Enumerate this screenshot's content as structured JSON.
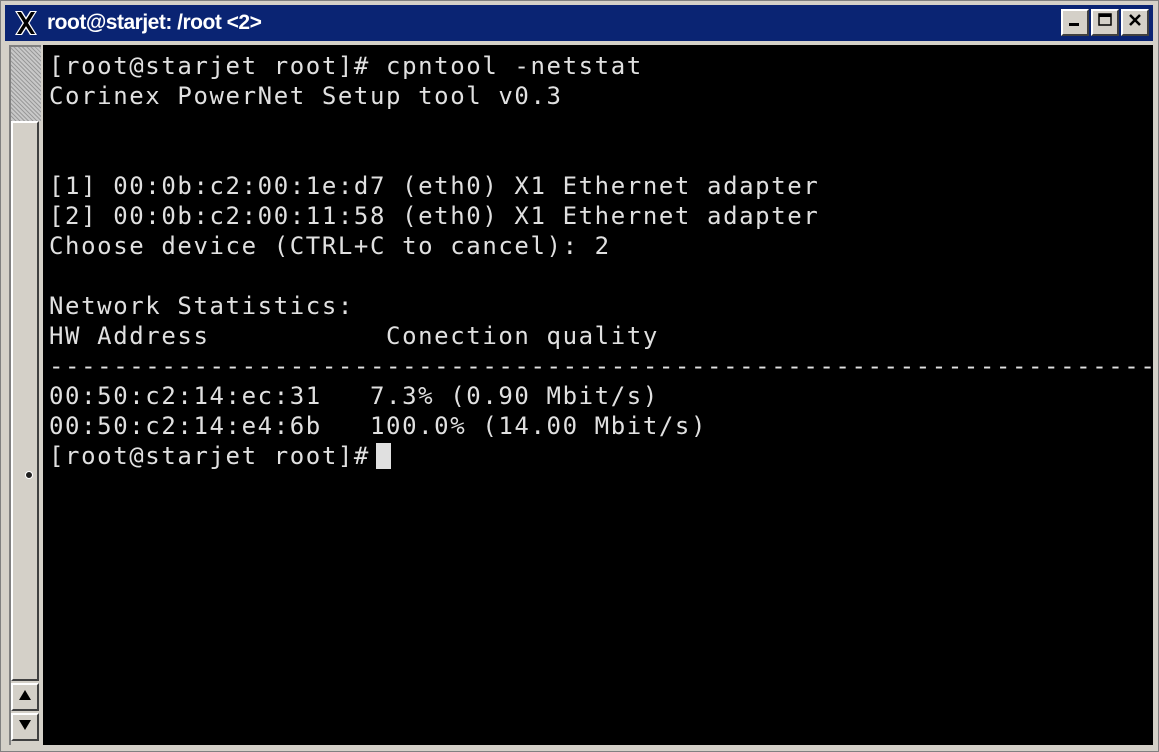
{
  "window": {
    "title": "root@starjet: /root <2>"
  },
  "icons": {
    "app": "x-logo-icon",
    "minimize": "minimize-icon",
    "maximize": "maximize-icon",
    "close": "close-icon",
    "scroll_up": "scroll-up-arrow-icon",
    "scroll_down": "scroll-down-arrow-icon"
  },
  "colors": {
    "titlebar": "#0a2473",
    "terminal_bg": "#000000",
    "terminal_fg": "#e0e0e0",
    "chrome": "#d4d0c8"
  },
  "terminal": {
    "lines": [
      "[root@starjet root]# cpntool -netstat",
      "Corinex PowerNet Setup tool v0.3",
      "",
      "",
      "[1] 00:0b:c2:00:1e:d7 (eth0) X1 Ethernet adapter",
      "[2] 00:0b:c2:00:11:58 (eth0) X1 Ethernet adapter",
      "Choose device (CTRL+C to cancel): 2",
      "",
      "Network Statistics:",
      "HW Address           Conection quality",
      "-------------------------------------------------------------------------",
      "00:50:c2:14:ec:31   7.3% (0.90 Mbit/s)",
      "00:50:c2:14:e4:6b   100.0% (14.00 Mbit/s)"
    ],
    "prompt": "[root@starjet root]#"
  }
}
